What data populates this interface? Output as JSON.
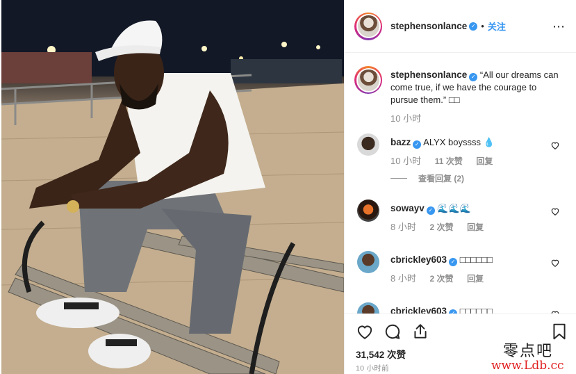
{
  "header": {
    "username": "stephensonlance",
    "separator": "•",
    "follow_label": "关注",
    "more_icon": "⋯"
  },
  "caption": {
    "username": "stephensonlance",
    "text": "“All our dreams can come true, if we have the courage to pursue them.” □□",
    "time": "10 小时"
  },
  "comments": [
    {
      "username": "bazz",
      "text": "ALYX boyssss 💧",
      "time": "10 小时",
      "likes": "11 次赞",
      "reply_label": "回复",
      "view_replies": "查看回复 (2)"
    },
    {
      "username": "sowayv",
      "text": "🌊🌊🌊",
      "time": "8 小时",
      "likes": "2 次赞",
      "reply_label": "回复"
    },
    {
      "username": "cbrickley603",
      "text": "□□□□□□",
      "time": "8 小时",
      "likes": "2 次赞",
      "reply_label": "回复"
    },
    {
      "username": "cbrickley603",
      "text": "□□□□□□"
    }
  ],
  "footer": {
    "likes": "31,542 次赞",
    "time": "10 小时前"
  },
  "watermark": {
    "line1": "零点吧",
    "line2": "www.Ldb.cc"
  },
  "colors": {
    "link_blue": "#3897f0",
    "verified_blue": "#3897f0",
    "muted_gray": "#8e8e8e",
    "text_dark": "#262626",
    "watermark_red": "#e02020"
  },
  "icons": [
    "heart-icon",
    "comment-icon",
    "share-icon",
    "bookmark-icon",
    "verified-badge-icon",
    "more-options-icon"
  ]
}
